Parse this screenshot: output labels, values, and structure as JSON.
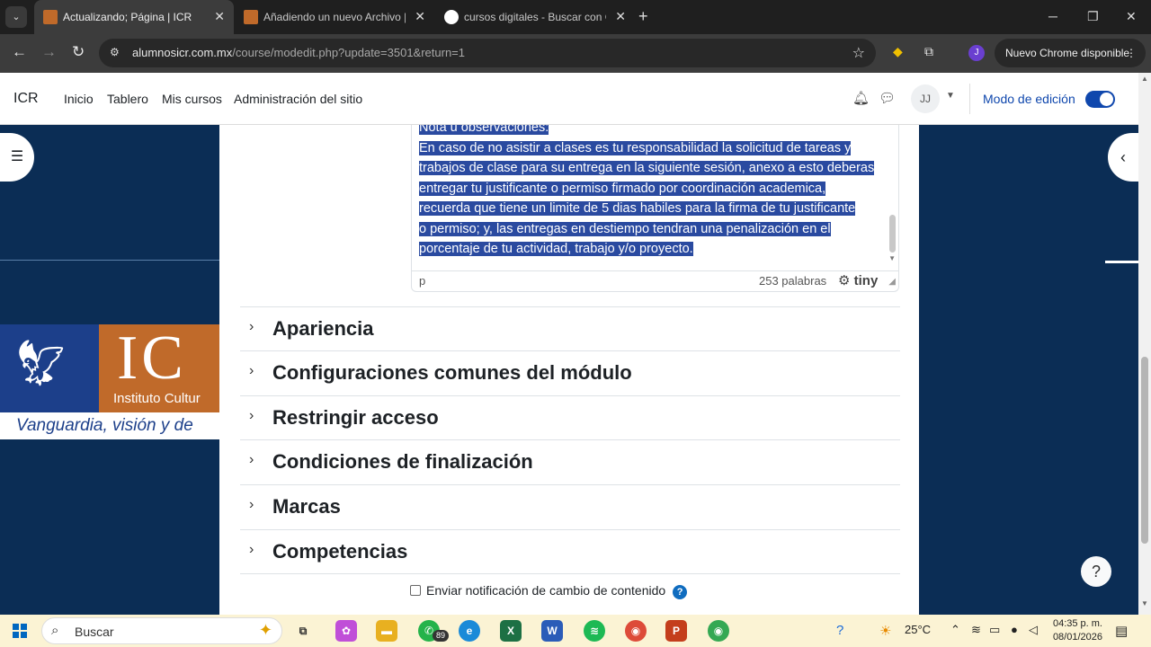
{
  "browser": {
    "tabs": [
      {
        "title": "Actualizando; Página | ICR",
        "active": true,
        "favicon_color": "#c06a2a"
      },
      {
        "title": "Añadiendo un nuevo Archivo | I",
        "active": false,
        "favicon_color": "#c06a2a"
      },
      {
        "title": "cursos digitales - Buscar con Go",
        "active": false,
        "favicon_color": "#ffffff"
      }
    ],
    "url_host": "alumnosicr.com.mx",
    "url_path": "/course/modedit.php?update=3501&return=1",
    "profile_initial": "J",
    "update_label": "Nuevo Chrome disponible"
  },
  "navbar": {
    "brand": "ICR",
    "links": [
      "Inicio",
      "Tablero",
      "Mis cursos",
      "Administración del sitio"
    ],
    "avatar_initials": "JJ",
    "edit_mode_label": "Modo de edición",
    "edit_mode_on": true,
    "accent": "#0f47ad"
  },
  "banner": {
    "letters": "IC",
    "institute": "Instituto Cultur",
    "tagline": "Vanguardia, visión y de"
  },
  "editor": {
    "lines": [
      "Nota u observaciones:",
      "En caso de no asistir a clases es tu responsabilidad la solicitud de tareas y",
      "trabajos de clase para su entrega en la siguiente sesión, anexo a esto deberas",
      "entregar tu justificante o permiso firmado por coordinación academica,",
      "recuerda que tiene un limite de 5 dias habiles para la firma de tu justificante",
      "o permiso; y,  las entregas en destiempo tendran una penalización en el",
      "porcentaje de tu actividad, trabajo y/o proyecto. "
    ],
    "status_element": "p",
    "word_count": "253 palabras",
    "brand": "tiny"
  },
  "sections": [
    "Apariencia",
    "Configuraciones comunes del módulo",
    "Restringir acceso",
    "Condiciones de finalización",
    "Marcas",
    "Competencias"
  ],
  "notify_label": "Enviar notificación de cambio de contenido",
  "help_fab": "?",
  "taskbar": {
    "search_placeholder": "Buscar",
    "whatsapp_badge": "89",
    "temperature": "25°C",
    "time": "04:35 p. m.",
    "date": "08/01/2026"
  }
}
